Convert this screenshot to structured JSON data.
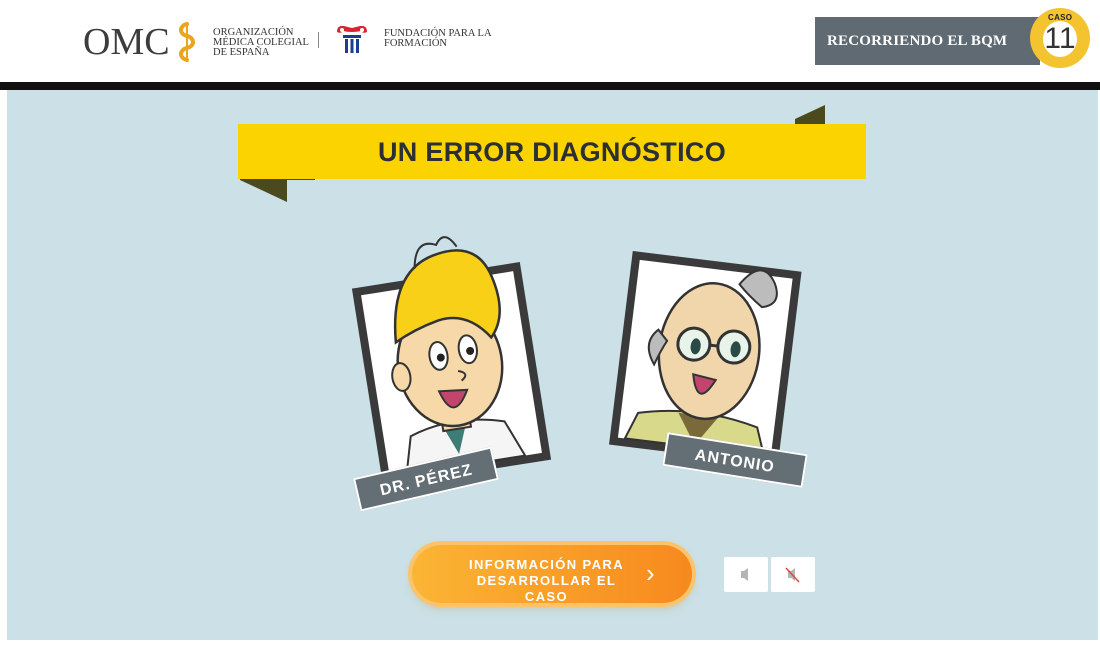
{
  "header": {
    "omc_text": "OMC",
    "org_line1": "ORGANIZACIÓN",
    "org_line2": "MÉDICA COLEGIAL",
    "org_line3": "DE ESPAÑA",
    "fund_line1": "FUNDACIÓN PARA LA",
    "fund_line2": "FORMACIÓN",
    "badge_label": "RECORRIENDO EL BQM",
    "case_label": "CASO",
    "case_number": "11"
  },
  "banner": {
    "title": "UN ERROR DIAGNÓSTICO"
  },
  "characters": [
    {
      "name": "DR. PÉREZ"
    },
    {
      "name": "ANTONIO"
    }
  ],
  "cta": {
    "line1": "INFORMACIÓN PARA",
    "line2": "DESARROLLAR EL CASO",
    "icon": "chevron-right-icon"
  },
  "sound": {
    "on_icon": "speaker-icon",
    "off_icon": "speaker-muted-icon"
  },
  "colors": {
    "stage_bg": "#cbe1e7",
    "banner_yellow": "#fbd400",
    "name_tag_gray": "#646e75",
    "cta_orange": "#f7891e",
    "header_badge_gray": "#5f6a72",
    "case_gold": "#f4c430"
  }
}
